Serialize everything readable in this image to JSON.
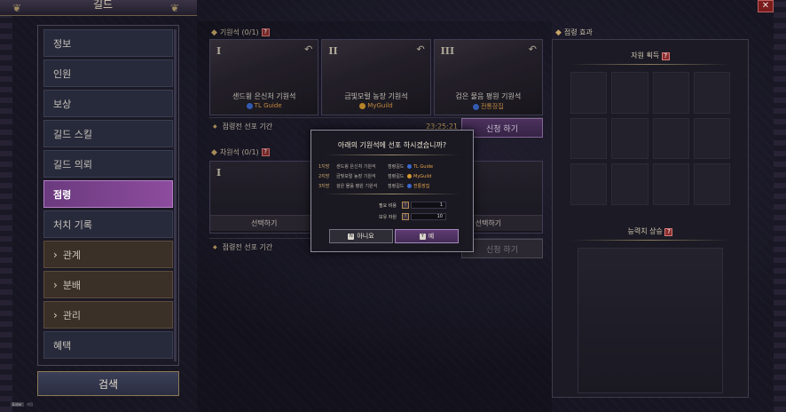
{
  "window": {
    "title": "길드",
    "close_label": "✕"
  },
  "sidebar": {
    "items": [
      {
        "label": "정보",
        "style": "normal"
      },
      {
        "label": "인원",
        "style": "normal"
      },
      {
        "label": "보상",
        "style": "normal"
      },
      {
        "label": "길드 스킬",
        "style": "normal"
      },
      {
        "label": "길드 의뢰",
        "style": "normal"
      },
      {
        "label": "점령",
        "style": "active"
      },
      {
        "label": "처치 기록",
        "style": "normal"
      },
      {
        "label": "관계",
        "style": "brown",
        "chevron": true
      },
      {
        "label": "분배",
        "style": "brown",
        "chevron": true
      },
      {
        "label": "관리",
        "style": "brown",
        "chevron": true
      },
      {
        "label": "혜택",
        "style": "normal"
      }
    ],
    "search_label": "검색"
  },
  "stones_section": {
    "header": "기원석 (0/1)",
    "cards": [
      {
        "numeral": "I",
        "name": "샌드윙 은신처 기원석",
        "guild": "TL Guide",
        "emblem": "blue"
      },
      {
        "numeral": "II",
        "name": "금빛모럴 농장 기원석",
        "guild": "MyGuild",
        "emblem": "gold"
      },
      {
        "numeral": "III",
        "name": "검은 물음 평원 기원석",
        "guild": "전통장집",
        "emblem": "blue"
      }
    ],
    "bar_label": "점령전 선포 기간",
    "timer": "23:25:21",
    "apply_label": "신청 하기"
  },
  "slots_section": {
    "header": "차원석 (0/1)",
    "numeral": "I",
    "select_label": "선택하기",
    "bar_label": "점령전 선포 기간",
    "apply_label": "신청 하기"
  },
  "effect_panel": {
    "header": "점령 효과",
    "resource_title": "자원 획득",
    "stat_title": "능력치 상승"
  },
  "modal": {
    "title": "아래의 기원석에 선포 하시겠습니까?",
    "rows": [
      {
        "rank": "1지망",
        "stone": "샌드윙 은신처 기원석",
        "word": "점령길드",
        "guild": "TL Guide"
      },
      {
        "rank": "2지망",
        "stone": "금빛모럴 농장 기원석",
        "word": "점령길드",
        "guild": "MyGuild"
      },
      {
        "rank": "3지망",
        "stone": "검은 물음 평원 기원석",
        "word": "점령길드",
        "guild": "전통장집"
      }
    ],
    "costs": [
      {
        "label": "필요 비용",
        "value": "1"
      },
      {
        "label": "보유 자원",
        "value": "10"
      }
    ],
    "no": {
      "key": "N",
      "label": "아니요"
    },
    "yes": {
      "key": "Y",
      "label": "예"
    }
  },
  "footer": {
    "key": "Enter",
    "label": "채팅"
  }
}
